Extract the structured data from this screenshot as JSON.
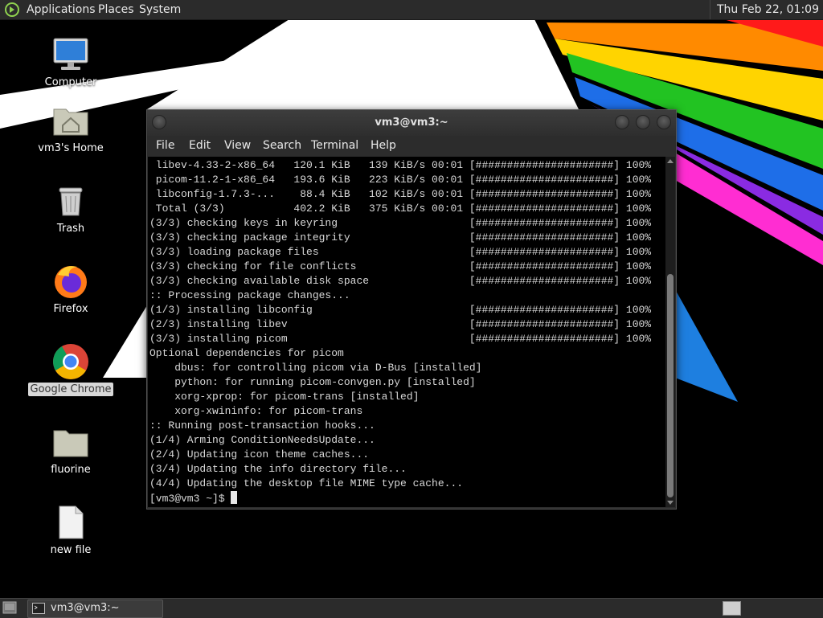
{
  "top_panel": {
    "applications": "Applications",
    "places": "Places",
    "system": "System",
    "clock": "Thu Feb 22, 01:09"
  },
  "desktop_icons": [
    {
      "label": "Computer",
      "icon": "computer-icon"
    },
    {
      "label": "vm3's Home",
      "icon": "home-folder-icon"
    },
    {
      "label": "Trash",
      "icon": "trash-icon"
    },
    {
      "label": "Firefox",
      "icon": "firefox-icon"
    },
    {
      "label": "Google Chrome",
      "icon": "chrome-icon"
    },
    {
      "label": "fluorine",
      "icon": "folder-icon"
    },
    {
      "label": "new file",
      "icon": "file-icon"
    }
  ],
  "terminal": {
    "title": "vm3@vm3:~",
    "menu": [
      "File",
      "Edit",
      "View",
      "Search",
      "Terminal",
      "Help"
    ],
    "lines": [
      " libev-4.33-2-x86_64   120.1 KiB   139 KiB/s 00:01 [######################] 100%",
      " picom-11.2-1-x86_64   193.6 KiB   223 KiB/s 00:01 [######################] 100%",
      " libconfig-1.7.3-...    88.4 KiB   102 KiB/s 00:01 [######################] 100%",
      " Total (3/3)           402.2 KiB   375 KiB/s 00:01 [######################] 100%",
      "(3/3) checking keys in keyring                     [######################] 100%",
      "(3/3) checking package integrity                   [######################] 100%",
      "(3/3) loading package files                        [######################] 100%",
      "(3/3) checking for file conflicts                  [######################] 100%",
      "(3/3) checking available disk space                [######################] 100%",
      ":: Processing package changes...",
      "(1/3) installing libconfig                         [######################] 100%",
      "(2/3) installing libev                             [######################] 100%",
      "(3/3) installing picom                             [######################] 100%",
      "Optional dependencies for picom",
      "    dbus: for controlling picom via D-Bus [installed]",
      "    python: for running picom-convgen.py [installed]",
      "    xorg-xprop: for picom-trans [installed]",
      "    xorg-xwininfo: for picom-trans",
      ":: Running post-transaction hooks...",
      "(1/4) Arming ConditionNeedsUpdate...",
      "(2/4) Updating icon theme caches...",
      "(3/4) Updating the info directory file...",
      "(4/4) Updating the desktop file MIME type cache..."
    ],
    "prompt": "[vm3@vm3 ~]$ "
  },
  "taskbar": {
    "task_label": "vm3@vm3:~"
  },
  "colors": {
    "panel": "#2b2b2b",
    "terminal_bg": "#000000",
    "terminal_fg": "#d8d8d8"
  }
}
